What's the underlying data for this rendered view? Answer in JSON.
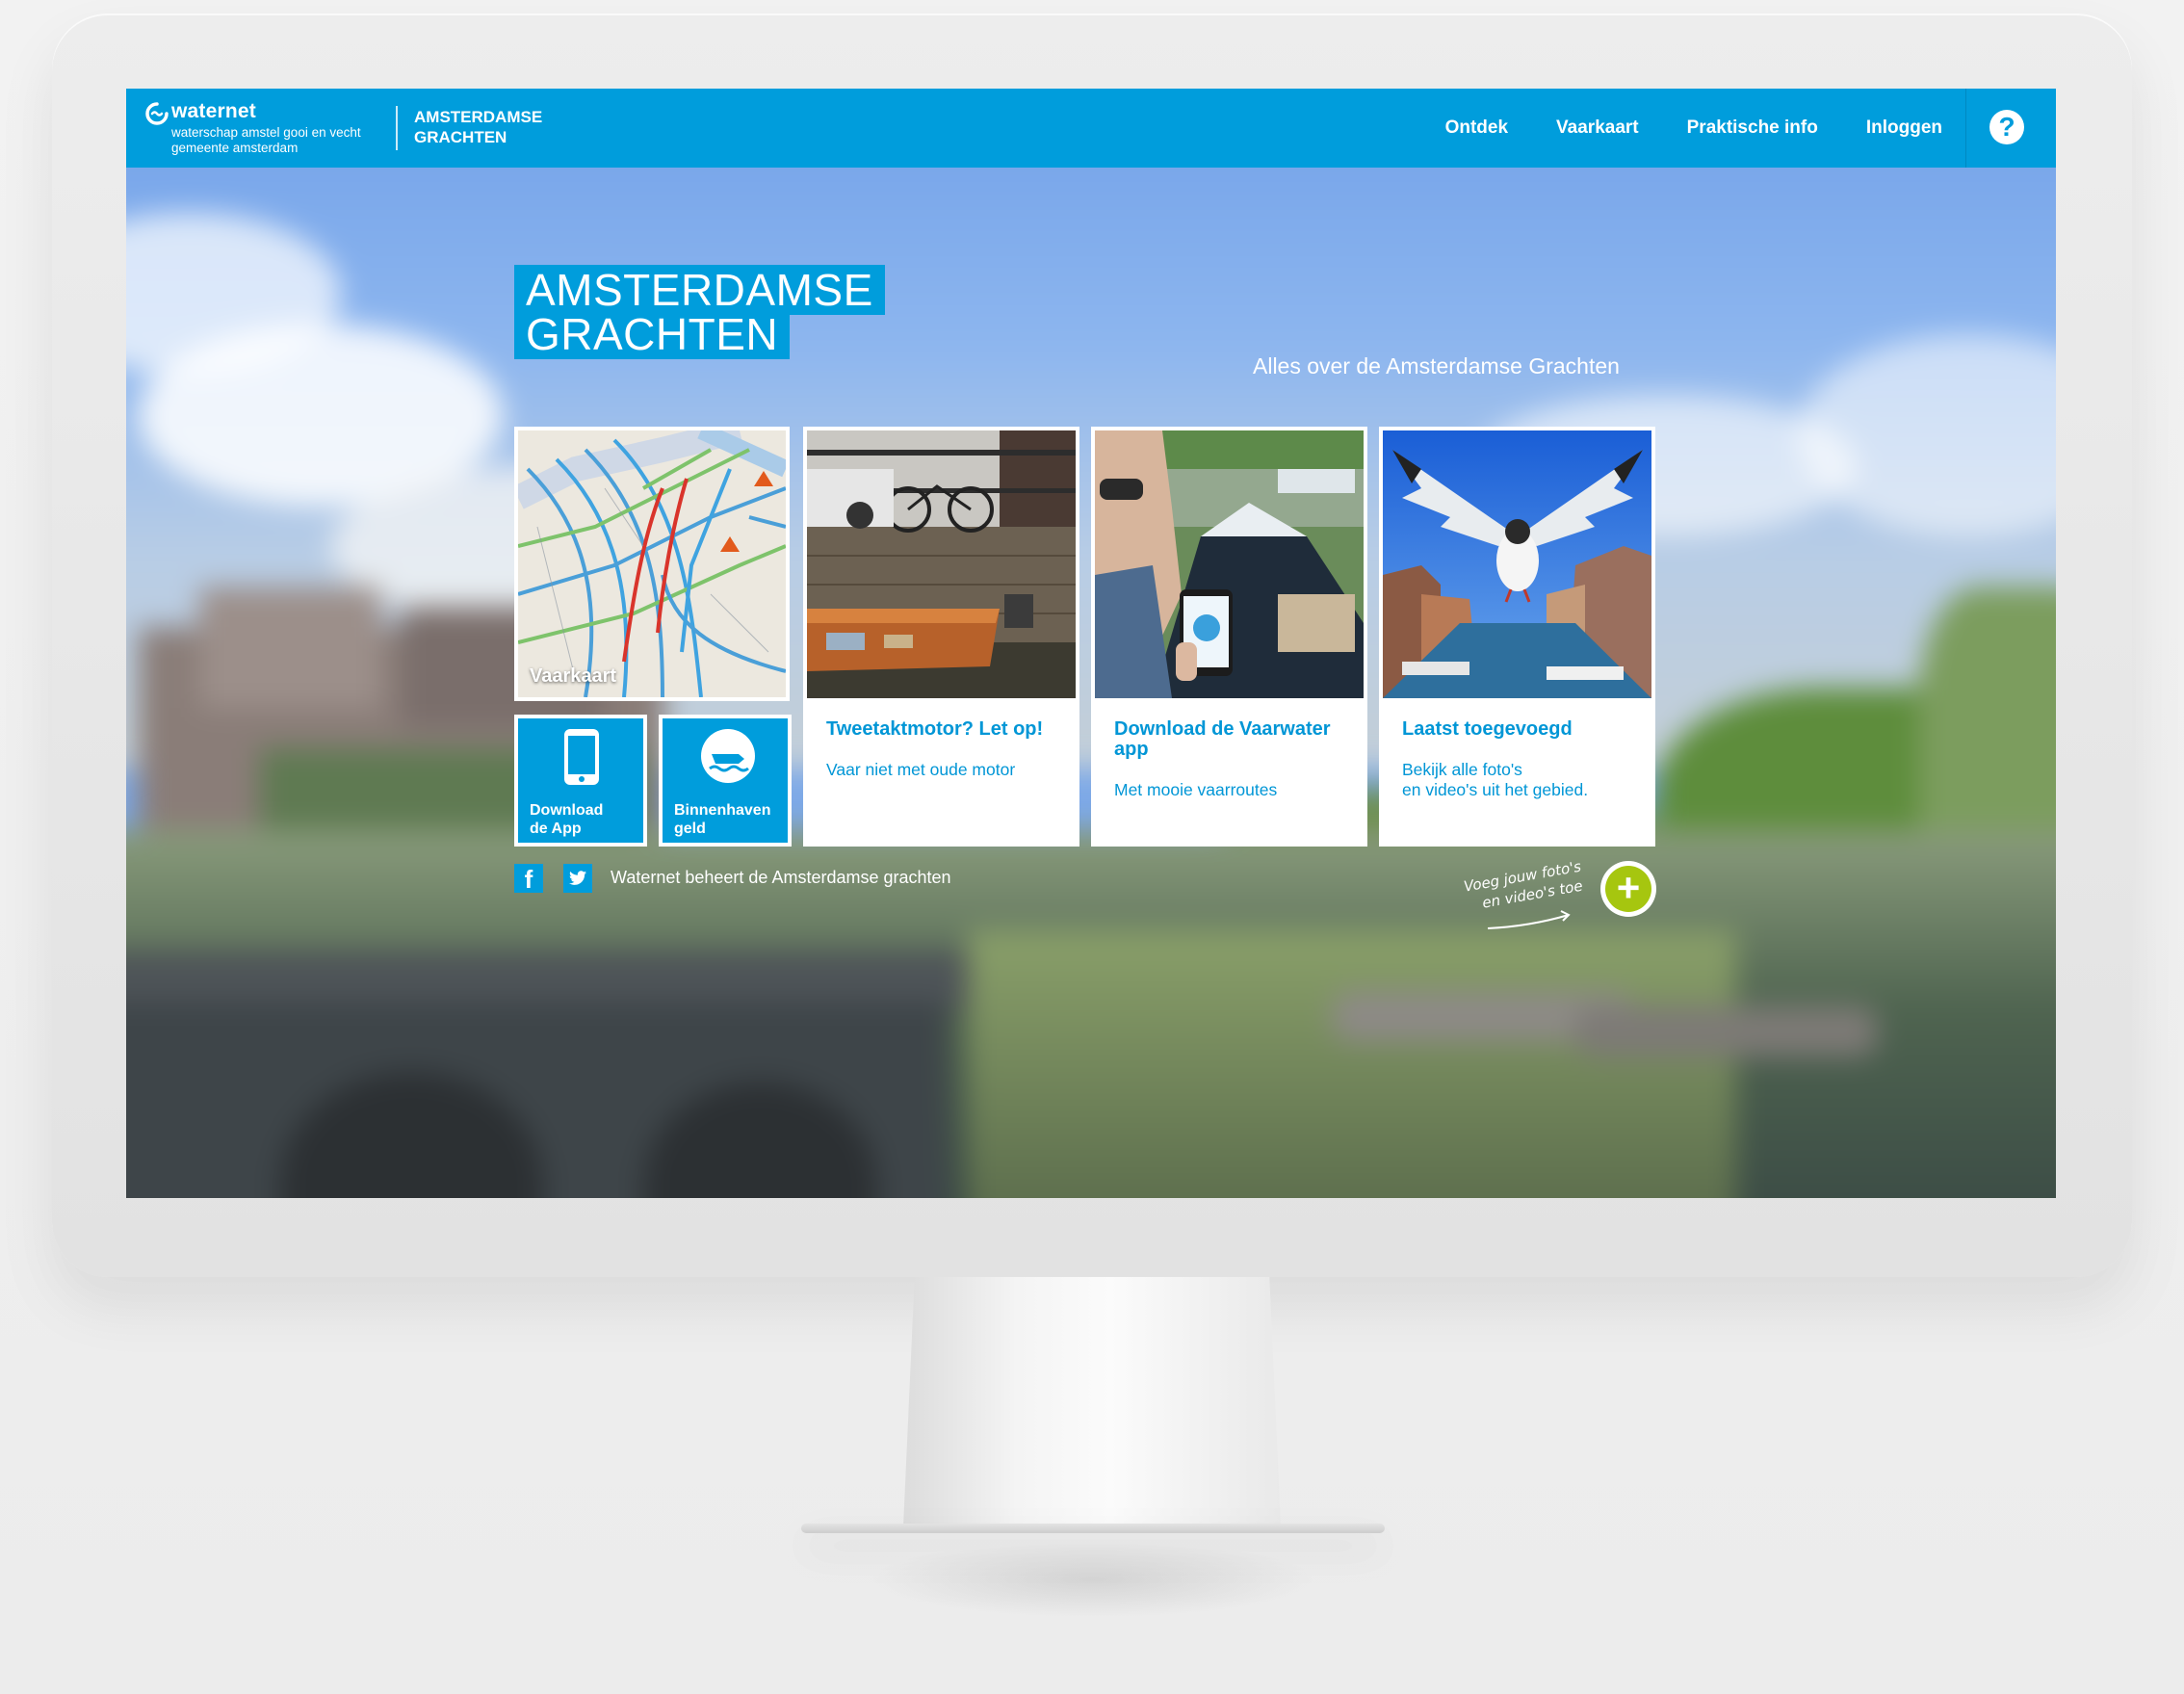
{
  "navbar": {
    "logo_name": "waternet",
    "logo_line1": "waterschap amstel gooi en vecht",
    "logo_line2": "gemeente amsterdam",
    "site_title_line1": "AMSTERDAMSE",
    "site_title_line2": "GRACHTEN",
    "links": [
      "Ontdek",
      "Vaarkaart",
      "Praktische info",
      "Inloggen"
    ],
    "help_symbol": "?"
  },
  "hero": {
    "title_line1": "AMSTERDAMSE",
    "title_line2": "GRACHTEN",
    "subtitle": "Alles over de Amsterdamse Grachten"
  },
  "tiles": {
    "map_label": "Vaarkaart",
    "app_label_line1": "Download",
    "app_label_line2": "de App",
    "haven_label_line1": "Binnenhaven",
    "haven_label_line2": "geld"
  },
  "cards": [
    {
      "title": "Tweetaktmotor? Let op!",
      "desc_line1": "Vaar niet met oude motor",
      "desc_line2": ""
    },
    {
      "title": "Download de Vaarwater app",
      "desc_line1": "Met mooie vaarroutes",
      "desc_line2": ""
    },
    {
      "title": "Laatst toegevoegd",
      "desc_line1": "Bekijk alle foto's",
      "desc_line2": "en video's uit het gebied."
    }
  ],
  "footer": {
    "text": "Waternet beheert de Amsterdamse grachten",
    "facebook_symbol": "f",
    "add_line1": "Voeg jouw foto's",
    "add_line2": "en video's toe",
    "add_symbol": "+"
  },
  "colors": {
    "brand_blue": "#009ddc",
    "card_text_blue": "#0096d6",
    "accent_green": "#a6c60f"
  },
  "icons": [
    "waternet-logo-icon",
    "help-icon",
    "phone-icon",
    "boat-icon",
    "facebook-icon",
    "twitter-icon",
    "plus-icon"
  ]
}
